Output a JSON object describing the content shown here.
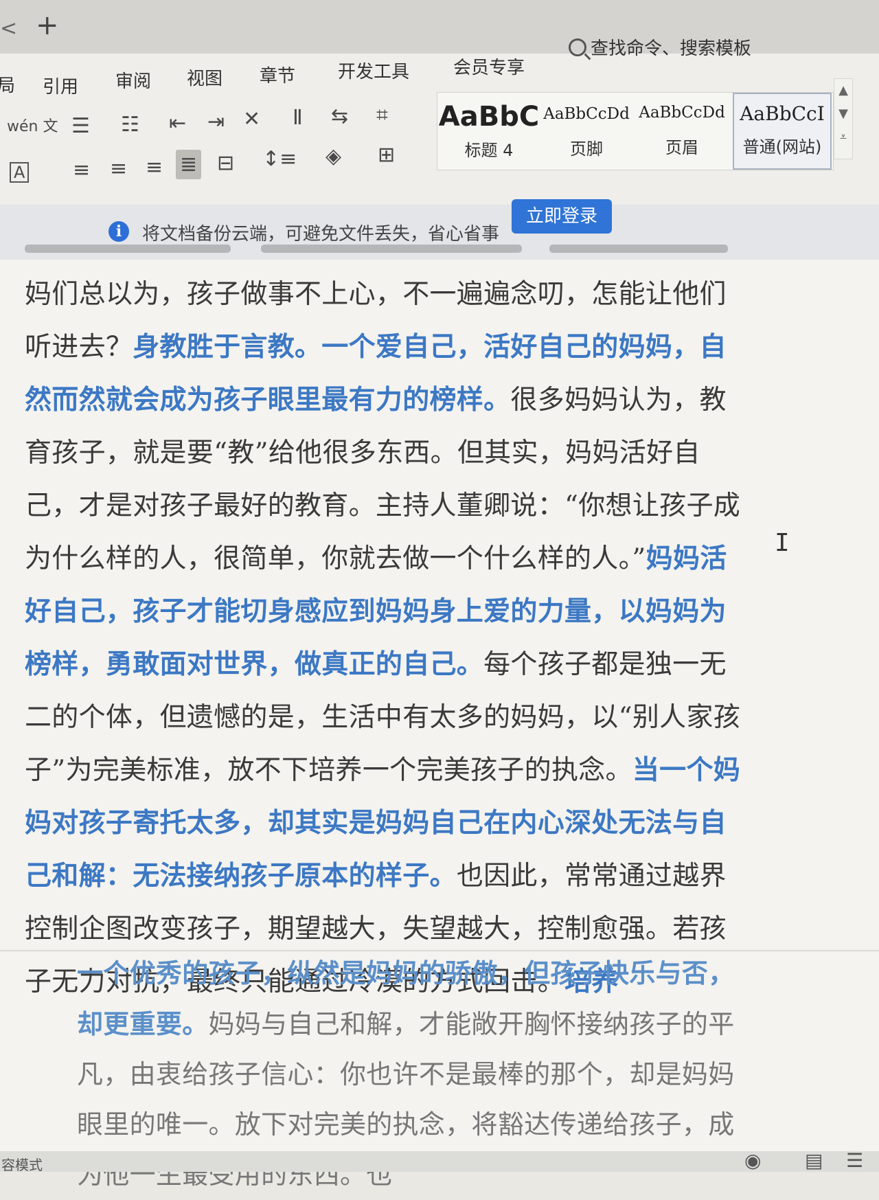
{
  "tabs": {
    "nav_glyph": "<",
    "add_glyph": "+"
  },
  "menu": {
    "partial": "局",
    "items": [
      "引用",
      "审阅",
      "视图",
      "章节",
      "开发工具",
      "会员专享"
    ],
    "search_label": "查找命令、搜索模板"
  },
  "ribbon": {
    "phonetic_glyph": "wén",
    "phonetic_char": "文",
    "border_char": "A",
    "styles": [
      {
        "sample": "AaBbC",
        "name": "标题 4"
      },
      {
        "sample": "AaBbCcDd",
        "name": "页脚"
      },
      {
        "sample": "AaBbCcDd",
        "name": "页眉"
      },
      {
        "sample": "AaBbCcI",
        "name": "普通(网站)"
      }
    ],
    "selected_style": "普通(网站)"
  },
  "notice": {
    "icon": "info-icon",
    "text": "将文档备份云端，可避免文件丢失，省心省事",
    "button": "立即登录"
  },
  "document": {
    "para1": [
      {
        "t": "妈们总以为，孩子做事不上心，不一遍遍念叨，怎能让他们听进去？",
        "bold": false
      },
      {
        "t": "身教胜于言教。一个爱自己，活好自己的妈妈，自然而然就会成为孩子眼里最有力的榜样。",
        "bold": true
      },
      {
        "t": "很多妈妈认为，教育孩子，就是要“教”给他很多东西。但其实，妈妈活好自己，才是对孩子最好的教育。主持人董卿说：“你想让孩子成为什么样的人，很简单，你就去做一个什么样的人。”",
        "bold": false
      },
      {
        "t": "妈妈活好自己，孩子才能切身感应到妈妈身上爱的力量，以妈妈为榜样，勇敢面对世界，做真正的自己。",
        "bold": true
      },
      {
        "t": "每个孩子都是独一无二的个体，但遗憾的是，生活中有太多的妈妈，以“别人家孩子”为完美标准，放不下培养一个完美孩子的执念。",
        "bold": false
      },
      {
        "t": "当一个妈妈对孩子寄托太多，却其实是妈妈自己在内心深处无法与自己和解：无法接纳孩子原本的样子。",
        "bold": true
      },
      {
        "t": "也因此，常常通过越界控制企图改变孩子，期望越大，失望越大，控制愈强。若孩子无力对抗，最终只能通过冷漠的方式回击。",
        "bold": false
      },
      {
        "t": "培养",
        "bold": true
      }
    ],
    "para2": [
      {
        "t": "一个优秀的孩子，纵然是妈妈的骄傲，但孩子快乐与否，却更重要。",
        "bold": true
      },
      {
        "t": "妈妈与自己和解，才能敞开胸怀接纳孩子的平凡，由衷给孩子信心：你也许不是最棒的那个，却是妈妈眼里的唯一。放下对完美的执念，将豁达传递给孩子，成为他一生最受用的东西。也",
        "bold": false
      }
    ]
  },
  "status": {
    "text": "容模式"
  },
  "colors": {
    "accent": "#2f74d6",
    "bold_text": "#3c78c4",
    "body_text": "#3a3a3a"
  }
}
